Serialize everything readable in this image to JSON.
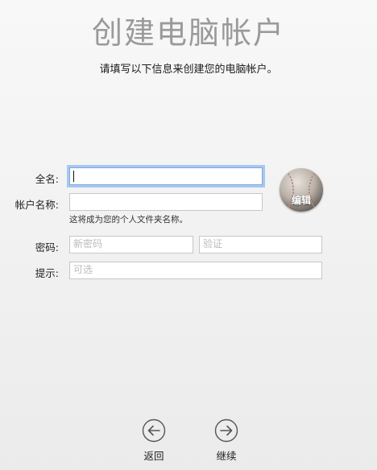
{
  "header": {
    "title": "创建电脑帐户",
    "subtitle": "请填写以下信息来创建您的电脑帐户。"
  },
  "form": {
    "full_name": {
      "label": "全名:",
      "value": ""
    },
    "account_name": {
      "label": "帐户名称:",
      "value": "",
      "note": "这将成为您的个人文件夹名称。"
    },
    "password": {
      "label": "密码:",
      "placeholder": "新密码",
      "verify_placeholder": "验证"
    },
    "hint": {
      "label": "提示:",
      "placeholder": "可选"
    }
  },
  "avatar": {
    "icon": "baseball-icon",
    "edit_label": "编辑"
  },
  "nav": {
    "back": {
      "label": "返回",
      "icon": "arrow-left-circle-icon"
    },
    "continue": {
      "label": "继续",
      "icon": "arrow-right-circle-icon"
    }
  }
}
